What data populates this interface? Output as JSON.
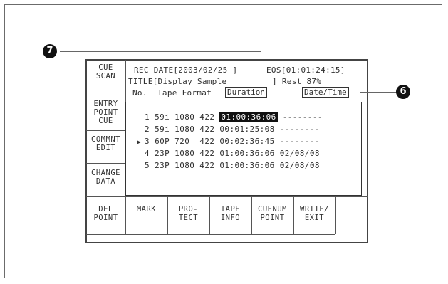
{
  "left_buttons": [
    {
      "label": "CUE\nSCAN"
    },
    {
      "label": "ENTRY\nPOINT\nCUE"
    },
    {
      "label": "COMMNT\nEDIT"
    },
    {
      "label": "CHANGE\nDATA"
    }
  ],
  "bottom_buttons": [
    {
      "label": "DEL\nPOINT"
    },
    {
      "label": "MARK"
    },
    {
      "label": "PRO-\nTECT"
    },
    {
      "label": "TAPE\nINFO"
    },
    {
      "label": "CUENUM\nPOINT"
    },
    {
      "label": "WRITE/\nEXIT"
    }
  ],
  "header": {
    "rec_date": "REC DATE[2003/02/25 ]",
    "eos": "EOS[01:01:24:15]",
    "title": "TITLE[Display Sample",
    "rest": "] Rest 87%",
    "col_no": "No.",
    "col_tape_format": "Tape Format",
    "col_duration": "Duration",
    "col_datetime": "Date/Time"
  },
  "rows": [
    {
      "no": "1",
      "fmt": "59i",
      "res": "1080",
      "sampling": "422",
      "duration": "01:00:36:06",
      "date": "--------",
      "selected": false
    },
    {
      "no": "2",
      "fmt": "59i",
      "res": "1080",
      "sampling": "422",
      "duration": "00:01:25:08",
      "date": "--------",
      "selected": false
    },
    {
      "no": "3",
      "fmt": "60P",
      "res": "720",
      "sampling": "422",
      "duration": "00:02:36:45",
      "date": "--------",
      "selected": true
    },
    {
      "no": "4",
      "fmt": "23P",
      "res": "1080",
      "sampling": "422",
      "duration": "01:00:36:06",
      "date": "02/08/08",
      "selected": false
    },
    {
      "no": "5",
      "fmt": "23P",
      "res": "1080",
      "sampling": "422",
      "duration": "01:00:36:06",
      "date": "02/08/08",
      "selected": false
    }
  ],
  "cursor": "▶",
  "callouts": {
    "duration_marker": "7",
    "datetime_marker": "6"
  }
}
